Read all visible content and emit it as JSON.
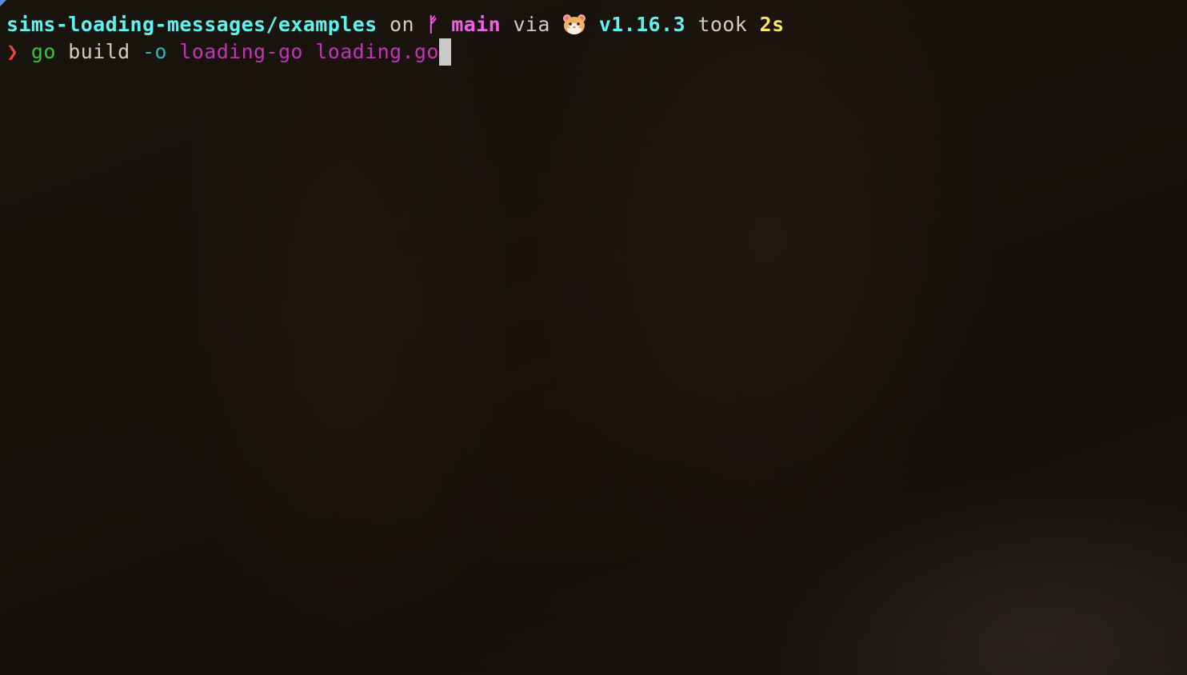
{
  "prompt_line": {
    "directory": "sims-loading-messages/examples",
    "on_text": " on ",
    "branch_symbol": "ᚠ",
    "branch": "main",
    "via_text": " via ",
    "toolchain_icon": "hamster-icon",
    "version": "v1.16.3",
    "took_text": " took ",
    "duration": "2s"
  },
  "command_line": {
    "prompt_symbol": "❯",
    "command": "go",
    "subcommand": "build",
    "flag": "-o",
    "output": "loading-go",
    "file": "loading.go"
  },
  "colors": {
    "directory": "#5ff3ef",
    "branch": "#f25ee6",
    "version": "#5ff3ef",
    "duration": "#f7e95d",
    "prompt": "#e24545",
    "command": "#38c438",
    "flag": "#2ab6c1",
    "path": "#c035b8",
    "cursor": "#c8c8c8"
  }
}
